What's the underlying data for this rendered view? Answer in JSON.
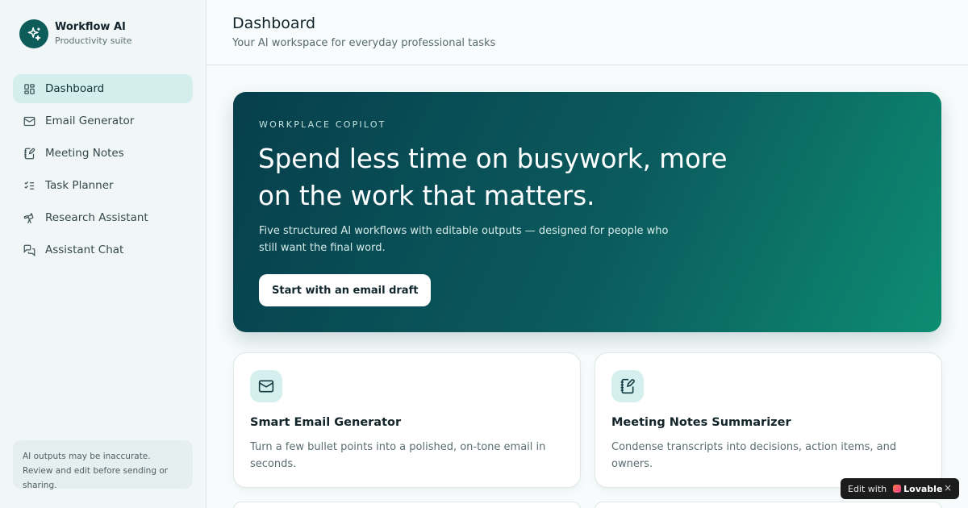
{
  "brand": {
    "name": "Workflow AI",
    "subtitle": "Productivity suite",
    "logo_icon": "sparkles-icon"
  },
  "sidebar": {
    "items": [
      {
        "label": "Dashboard",
        "icon": "dashboard-grid-icon",
        "active": true
      },
      {
        "label": "Email Generator",
        "icon": "mail-icon",
        "active": false
      },
      {
        "label": "Meeting Notes",
        "icon": "notebook-pen-icon",
        "active": false
      },
      {
        "label": "Task Planner",
        "icon": "list-checks-icon",
        "active": false
      },
      {
        "label": "Research Assistant",
        "icon": "telescope-icon",
        "active": false
      },
      {
        "label": "Assistant Chat",
        "icon": "chat-bubbles-icon",
        "active": false
      }
    ],
    "disclaimer": "AI outputs may be inaccurate. Review and edit before sending or sharing."
  },
  "header": {
    "title": "Dashboard",
    "subtitle": "Your AI workspace for everyday professional tasks"
  },
  "hero": {
    "eyebrow": "WORKPLACE COPILOT",
    "title": "Spend less time on busywork, more on the work that matters.",
    "description": "Five structured AI workflows with editable outputs — designed for people who still want the final word.",
    "cta": "Start with an email draft"
  },
  "cards": [
    {
      "title": "Smart Email Generator",
      "description": "Turn a few bullet points into a polished, on-tone email in seconds.",
      "icon": "mail-icon"
    },
    {
      "title": "Meeting Notes Summarizer",
      "description": "Condense transcripts into decisions, action items, and owners.",
      "icon": "notebook-pen-icon"
    }
  ],
  "badge": {
    "prefix": "Edit with",
    "brand": "Lovable",
    "close": "×"
  },
  "colors": {
    "accent": "#0d5c5a",
    "hero_start": "#063f4c",
    "hero_end": "#0d8d72",
    "active_nav": "#d3eeec"
  }
}
